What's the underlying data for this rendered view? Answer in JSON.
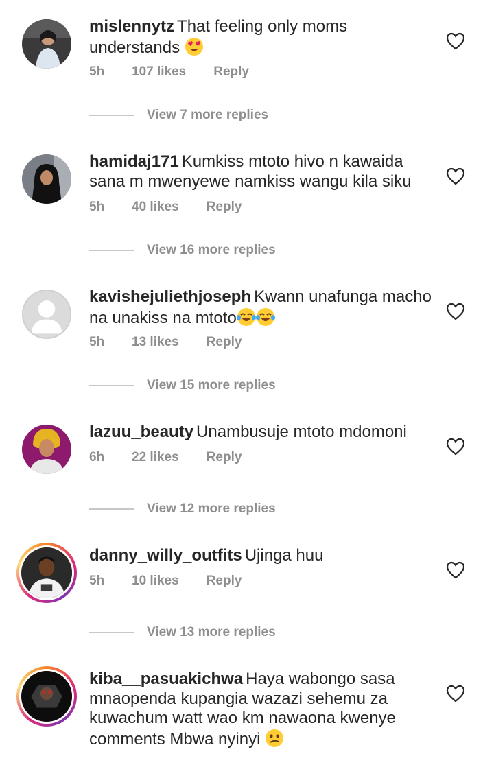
{
  "comments": [
    {
      "username": "mislennytz",
      "text": "That feeling only moms understands",
      "emoji": "heart-eyes",
      "time": "5h",
      "likes": "107 likes",
      "reply_label": "Reply",
      "view_replies": "View 7 more replies",
      "avatar": "photo-woman-in-car"
    },
    {
      "username": "hamidaj171",
      "text": "Kumkiss mtoto hivo n kawaida sana m mwenyewe namkiss wangu kila siku",
      "time": "5h",
      "likes": "40 likes",
      "reply_label": "Reply",
      "view_replies": "View 16 more replies",
      "avatar": "photo-woman-hijab"
    },
    {
      "username": "kavishejuliethjoseph",
      "text": "Kwann unafunga macho na unakiss na mtoto",
      "emoji": "laughing-tears x2",
      "time": "5h",
      "likes": "13 likes",
      "reply_label": "Reply",
      "view_replies": "View 15 more replies",
      "avatar": "default-avatar"
    },
    {
      "username": "lazuu_beauty",
      "text": "Unambusuje mtoto mdomoni",
      "time": "6h",
      "likes": "22 likes",
      "reply_label": "Reply",
      "view_replies": "View 12 more replies",
      "avatar": "photo-woman-headwrap"
    },
    {
      "username": "danny_willy_outfits",
      "text": "Ujinga huu",
      "time": "5h",
      "likes": "10 likes",
      "reply_label": "Reply",
      "view_replies": "View 13 more replies",
      "avatar": "photo-man-story-ring"
    },
    {
      "username": "kiba__pasuakichwa",
      "text": "Haya wabongo sasa mnaopenda kupangia wazazi sehemu za kuwachum watt wao km nawaona kwenye comments Mbwa nyinyi",
      "emoji": "confused-face",
      "avatar": "photo-figure-story-ring"
    }
  ],
  "colors": {
    "text": "#262626",
    "muted": "#8e8e8e",
    "divider": "#c7c7c7"
  }
}
